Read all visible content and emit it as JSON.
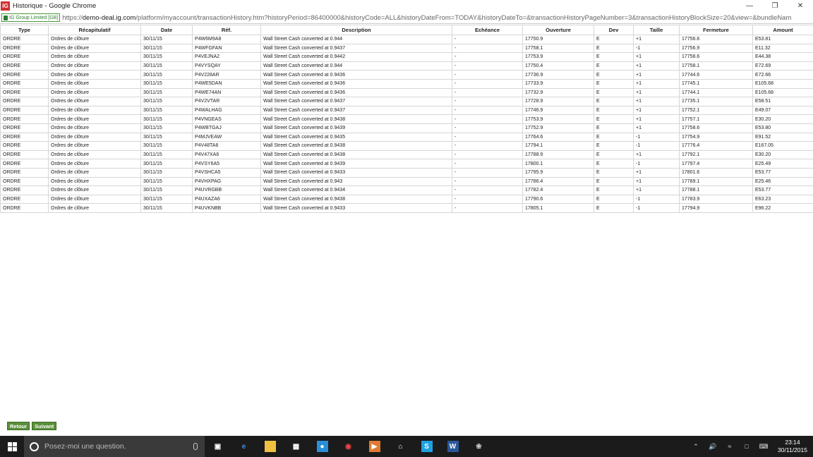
{
  "window": {
    "title": "Historique - Google Chrome",
    "logo_text": "IG"
  },
  "address": {
    "badge": "IG Group Limited [GB]",
    "url_prefix": "https://",
    "url_host": "demo-deal.ig.com",
    "url_rest": "/platform/myaccount/transactionHistory.htm?historyPeriod=86400000&historyCode=ALL&historyDateFrom=TODAY&historyDateTo=&transactionHistoryPageNumber=3&transactionHistoryBlockSize=20&view=&bundleNam"
  },
  "table": {
    "headers": [
      "Type",
      "Récapitulatif",
      "Date",
      "Réf.",
      "Description",
      "Echéance",
      "Ouverture",
      "Dev",
      "Taille",
      "Fermeture",
      "Amount"
    ],
    "rows": [
      [
        "ORDRE",
        "Ordres de clôture",
        "30/11/15",
        "P4W6M9A8",
        "Wall Street Cash converted at 0.944",
        "-",
        "17750.9",
        "E",
        "+1",
        "17756.6",
        "E53.81"
      ],
      [
        "ORDRE",
        "Ordres de clôture",
        "30/11/15",
        "P4WFGFAN",
        "Wall Street Cash converted at 0.9437",
        "-",
        "17758.1",
        "E",
        "-1",
        "17756.9",
        "E11.32"
      ],
      [
        "ORDRE",
        "Ordres de clôture",
        "30/11/15",
        "P4VEJNA2",
        "Wall Street Cash converted at 0.9442",
        "-",
        "17753.9",
        "E",
        "+1",
        "17758.6",
        "E44.38"
      ],
      [
        "ORDRE",
        "Ordres de clôture",
        "30/11/15",
        "P4VYSQAY",
        "Wall Street Cash converted at 0.944",
        "-",
        "17750.4",
        "E",
        "+1",
        "17758.1",
        "E72.69"
      ],
      [
        "ORDRE",
        "Ordres de clôture",
        "30/11/15",
        "P4V228AR",
        "Wall Street Cash converted at 0.9436",
        "-",
        "17736.9",
        "E",
        "+1",
        "17744.6",
        "E72.66"
      ],
      [
        "ORDRE",
        "Ordres de clôture",
        "30/11/15",
        "P4WE5DAN",
        "Wall Street Cash converted at 0.9436",
        "-",
        "17733.9",
        "E",
        "+1",
        "17745.1",
        "E105.68"
      ],
      [
        "ORDRE",
        "Ordres de clôture",
        "30/11/15",
        "P4WE74AN",
        "Wall Street Cash converted at 0.9436",
        "-",
        "17732.9",
        "E",
        "+1",
        "17744.1",
        "E105.68"
      ],
      [
        "ORDRE",
        "Ordres de clôture",
        "30/11/15",
        "P4V2VTAR",
        "Wall Street Cash converted at 0.9437",
        "-",
        "17728.9",
        "E",
        "+1",
        "17735.1",
        "E58.51"
      ],
      [
        "ORDRE",
        "Ordres de clôture",
        "30/11/15",
        "P4WALHAG",
        "Wall Street Cash converted at 0.9437",
        "-",
        "17746.9",
        "E",
        "+1",
        "17752.1",
        "E49.07"
      ],
      [
        "ORDRE",
        "Ordres de clôture",
        "30/11/15",
        "P4VNGEAS",
        "Wall Street Cash converted at 0.9438",
        "-",
        "17753.9",
        "E",
        "+1",
        "17757.1",
        "E30.20"
      ],
      [
        "ORDRE",
        "Ordres de clôture",
        "30/11/15",
        "P4WBTGAJ",
        "Wall Street Cash converted at 0.9439",
        "-",
        "17752.9",
        "E",
        "+1",
        "17758.6",
        "E53.80"
      ],
      [
        "ORDRE",
        "Ordres de clôture",
        "30/11/15",
        "P4MJVEAW",
        "Wall Street Cash converted at 0.9435",
        "-",
        "17764.6",
        "E",
        "-1",
        "17754.9",
        "E91.52"
      ],
      [
        "ORDRE",
        "Ordres de clôture",
        "30/11/15",
        "P4V48TA6",
        "Wall Street Cash converted at 0.9438",
        "-",
        "17794.1",
        "E",
        "-1",
        "17776.4",
        "E167.05"
      ],
      [
        "ORDRE",
        "Ordres de clôture",
        "30/11/15",
        "P4V47XA6",
        "Wall Street Cash converted at 0.9438",
        "-",
        "17788.9",
        "E",
        "+1",
        "17792.1",
        "E30.20"
      ],
      [
        "ORDRE",
        "Ordres de clôture",
        "30/11/15",
        "P4VSY6A5",
        "Wall Street Cash converted at 0.9439",
        "-",
        "17800.1",
        "E",
        "-1",
        "17797.4",
        "E25.49"
      ],
      [
        "ORDRE",
        "Ordres de clôture",
        "30/11/15",
        "P4VSHCA5",
        "Wall Street Cash converted at 0.9433",
        "-",
        "17795.9",
        "E",
        "+1",
        "17801.6",
        "E53.77"
      ],
      [
        "ORDRE",
        "Ordres de clôture",
        "30/11/15",
        "P4VHXPAG",
        "Wall Street Cash converted at 0.943",
        "-",
        "17786.4",
        "E",
        "+1",
        "17789.1",
        "E25.46"
      ],
      [
        "ORDRE",
        "Ordres de clôture",
        "30/11/15",
        "P4UVRGBB",
        "Wall Street Cash converted at 0.9434",
        "-",
        "17782.4",
        "E",
        "+1",
        "17788.1",
        "E53.77"
      ],
      [
        "ORDRE",
        "Ordres de clôture",
        "30/11/15",
        "P4UXAZA6",
        "Wall Street Cash converted at 0.9438",
        "-",
        "17790.6",
        "E",
        "-1",
        "17783.9",
        "E63.23"
      ],
      [
        "ORDRE",
        "Ordres de clôture",
        "30/11/15",
        "P4UVKNBB",
        "Wall Street Cash converted at 0.9433",
        "-",
        "17805.1",
        "E",
        "-1",
        "17794.9",
        "E96.22"
      ]
    ]
  },
  "pager": {
    "back_label": "Retour",
    "next_label": "Suivant"
  },
  "taskbar": {
    "search_placeholder": "Posez-moi une question.",
    "apps": [
      "task-view-icon",
      "edge-icon",
      "file-explorer-icon",
      "store-icon",
      "skype-blue-icon",
      "chrome-icon",
      "media-player-icon",
      "home-icon",
      "skype-icon",
      "word-icon",
      "paint-icon"
    ],
    "time": "23:14",
    "date": "30/11/2015"
  },
  "colors": {
    "button_green": "#5a8f3a",
    "taskbar": "#1b1b1b",
    "secure_green": "#2e7d32"
  }
}
